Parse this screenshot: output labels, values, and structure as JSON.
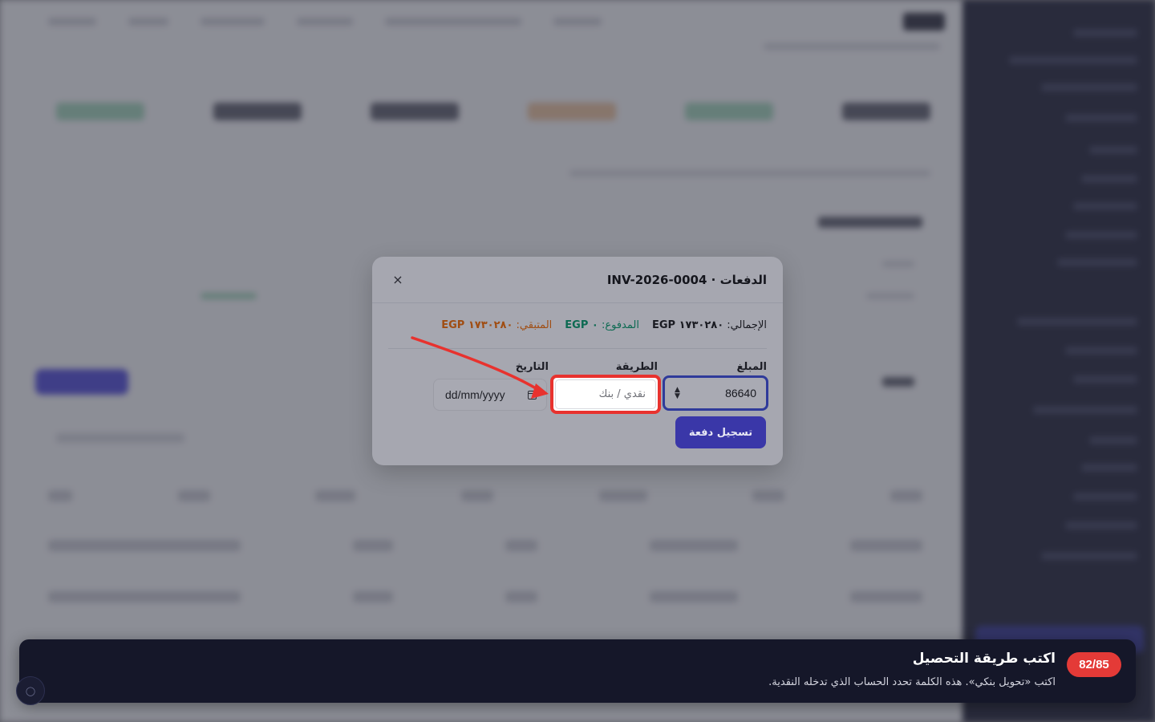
{
  "modal": {
    "title": "الدفعات · INV-2026-0004",
    "close_glyph": "×",
    "summary": {
      "total_label": "الإجمالي:",
      "total_value": "١٧٣٠٢٨٠ EGP",
      "paid_label": "المدفوع:",
      "paid_value": "٠ EGP",
      "remaining_label": "المتبقي:",
      "remaining_value": "١٧٣٠٢٨٠ EGP"
    },
    "fields": {
      "amount_label": "المبلغ",
      "amount_value": "86640",
      "method_label": "الطريقة",
      "method_placeholder": "نقدي / بنك",
      "date_label": "التاريخ",
      "date_placeholder": "dd/mm/yyyy"
    },
    "submit_label": "تسجيل دفعة"
  },
  "toast": {
    "step": "82/85",
    "title": "اكتب طريقة التحصيل",
    "description": "اكتب «تحويل بنكي». هذه الكلمة تحدد الحساب الذي تدخله النقدية."
  },
  "colors": {
    "highlight": "#e8322e",
    "primary": "#3a37a8",
    "paid": "#0d6a52",
    "remaining": "#a04d12"
  }
}
